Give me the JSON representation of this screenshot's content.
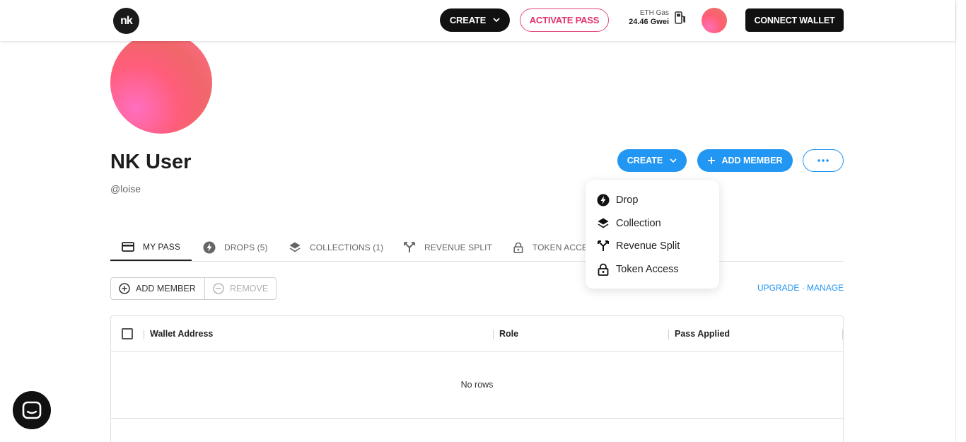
{
  "header": {
    "logo_text": "nk",
    "create_label": "CREATE",
    "activate_label": "ACTIVATE PASS",
    "gas_label": "ETH Gas",
    "gas_value": "24.46 Gwei",
    "connect_label": "CONNECT WALLET"
  },
  "profile": {
    "name": "NK User",
    "handle": "@loise",
    "create_label": "CREATE",
    "add_member_label": "ADD MEMBER"
  },
  "create_menu": {
    "items": [
      {
        "label": "Drop",
        "icon": "bolt-icon"
      },
      {
        "label": "Collection",
        "icon": "layers-icon"
      },
      {
        "label": "Revenue Split",
        "icon": "split-icon"
      },
      {
        "label": "Token Access",
        "icon": "lock-icon"
      }
    ]
  },
  "tabs": [
    {
      "label": "MY PASS",
      "icon": "card-icon",
      "active": true
    },
    {
      "label": "DROPS (5)",
      "icon": "bolt-icon"
    },
    {
      "label": "COLLECTIONS (1)",
      "icon": "layers-icon"
    },
    {
      "label": "REVENUE SPLIT",
      "icon": "split-icon"
    },
    {
      "label": "TOKEN ACCE",
      "icon": "lock-icon"
    }
  ],
  "toolbar": {
    "add_member_label": "ADD MEMBER",
    "remove_label": "REMOVE",
    "upgrade_label": "UPGRADE",
    "separator": "·",
    "manage_label": "MANAGE"
  },
  "grid": {
    "columns": [
      "Wallet Address",
      "Role",
      "Pass Applied"
    ],
    "empty_text": "No rows"
  },
  "colors": {
    "accent": "#2196f3",
    "pink": "#e0336b",
    "dark": "#111111"
  }
}
